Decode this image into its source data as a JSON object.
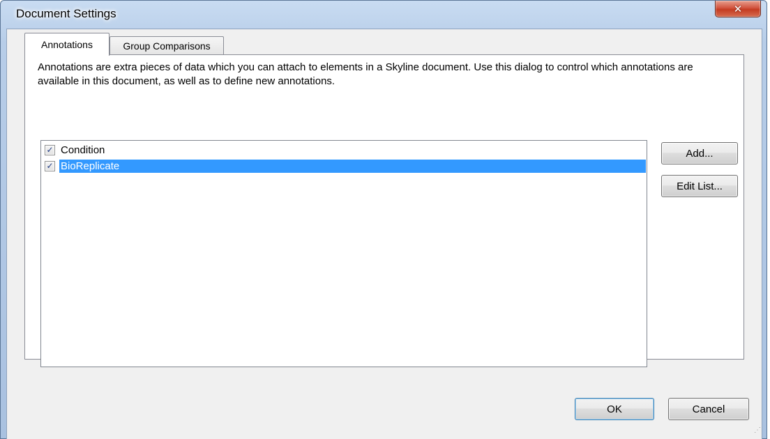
{
  "window": {
    "title": "Document Settings",
    "close_glyph": "✕"
  },
  "tabs": [
    {
      "label": "Annotations",
      "active": true
    },
    {
      "label": "Group Comparisons",
      "active": false
    }
  ],
  "annotations_tab": {
    "description": "Annotations are extra pieces of data which you can attach to elements in a Skyline document. Use this dialog to control which annotations are available in this document, as well as to define new annotations.",
    "items": [
      {
        "label": "Condition",
        "checked": true,
        "selected": false
      },
      {
        "label": "BioReplicate",
        "checked": true,
        "selected": true
      }
    ],
    "add_button": "Add...",
    "edit_list_button": "Edit List..."
  },
  "footer": {
    "ok_button": "OK",
    "cancel_button": "Cancel"
  },
  "icons": {
    "checkmark": "✓"
  },
  "colors": {
    "selection": "#3399ff",
    "close_button": "#c43c22",
    "title_bar": "#b7cde8",
    "dialog_background": "#f0f0f0"
  }
}
